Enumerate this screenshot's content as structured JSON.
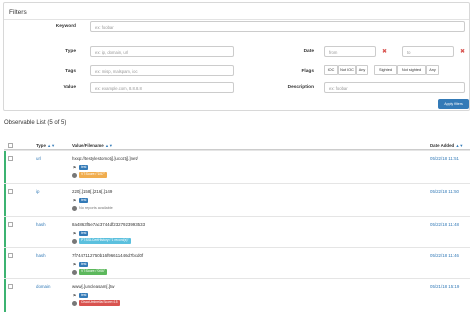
{
  "filters": {
    "title": "Filters",
    "keyword": {
      "label": "Keyword",
      "placeholder": "ex: foobar"
    },
    "type": {
      "label": "Type",
      "placeholder": "ex: ip, domain, url"
    },
    "tags": {
      "label": "Tags",
      "placeholder": "ex: misp, malspam, ioc"
    },
    "value": {
      "label": "Value",
      "placeholder": "ex: example.com, 8.8.8.8"
    },
    "date": {
      "label": "Date",
      "from_placeholder": "from",
      "to_placeholder": "to",
      "clear_symbol": "✖"
    },
    "flags": {
      "label": "Flags",
      "options": [
        "IOC",
        "Not IOC",
        "Any",
        "Sighted",
        "Not sighted",
        "Any"
      ]
    },
    "description": {
      "label": "Description",
      "placeholder": "ex: foobar"
    },
    "apply_label": "Apply filters"
  },
  "list": {
    "title": "Observable List (5 of 5)",
    "columns": {
      "type": "Type",
      "value": "Value/Filename",
      "date": "Date Added",
      "sort_glyph": "▲▼"
    },
    "rows": [
      {
        "type": "url",
        "value": "hxxp://testylestomotj[.]ucoztj[.]net/",
        "tag": "test",
        "analyzer": "VT:Score=\"1/67\"",
        "date": "05/22/18 11:51"
      },
      {
        "type": "ip",
        "value": "220[.]158[.]216[.]149",
        "tag": "test",
        "analyzer": "No reports available",
        "date": "05/22/18 11:50"
      },
      {
        "type": "hash",
        "value": "8a4863f5e7ac3744df2327923993533",
        "tag": "test",
        "analyzer": "PT:SSLCertHistory=\"1 record(s)\"",
        "date": "05/22/18 11:48"
      },
      {
        "type": "hash",
        "value": "7f7447112750b16f96611446d7bcd0f",
        "tag": "test",
        "analyzer": "VT:Score=\"0/66\"",
        "date": "05/22/18 11:46"
      },
      {
        "type": "domain",
        "value": "www[.]uncleasam[.]tw",
        "tag": "test",
        "analyzer": "CiscoUmbrella:Score=15",
        "date": "05/21/18 15:19"
      }
    ]
  },
  "colors": {
    "link": "#337ab7",
    "row_bar": "#3cb371",
    "badge_orange": "#f0ad4e",
    "badge_cyan": "#5bc0de",
    "badge_green": "#5cb85c",
    "badge_red": "#d9534f"
  }
}
